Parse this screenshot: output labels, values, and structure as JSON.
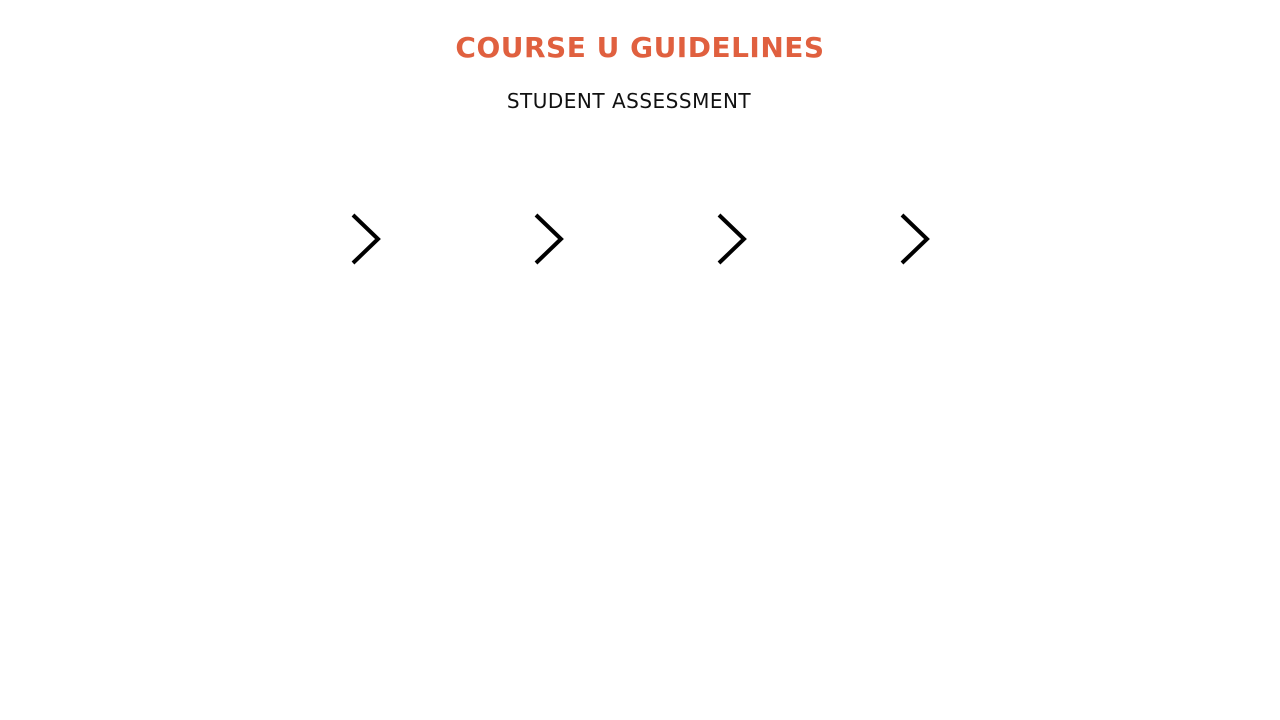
{
  "header": {
    "title": "COURSE U GUIDELINES",
    "subtitle": "STUDENT ASSESSMENT"
  },
  "colors": {
    "title": "#e0603f",
    "chevron": "#000000",
    "background": "#ffffff"
  },
  "chevrons": [
    {
      "icon": "chevron-right-icon"
    },
    {
      "icon": "chevron-right-icon"
    },
    {
      "icon": "chevron-right-icon"
    },
    {
      "icon": "chevron-right-icon"
    }
  ]
}
